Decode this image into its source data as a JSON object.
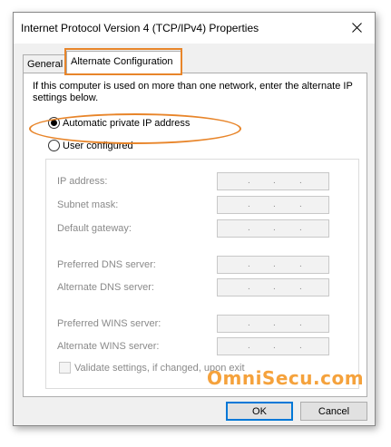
{
  "window": {
    "title": "Internet Protocol Version 4 (TCP/IPv4) Properties"
  },
  "tabs": [
    {
      "label": "General",
      "selected": false
    },
    {
      "label": "Alternate Configuration",
      "selected": true
    }
  ],
  "panel": {
    "description": "If this computer is used on more than one network, enter the alternate IP settings below.",
    "options": {
      "automatic": {
        "label": "Automatic private IP address",
        "checked": true
      },
      "user": {
        "label": "User configured",
        "checked": false
      }
    },
    "fields": {
      "ip_address": {
        "label": "IP address:",
        "value": ". . ."
      },
      "subnet_mask": {
        "label": "Subnet mask:",
        "value": ". . ."
      },
      "default_gateway": {
        "label": "Default gateway:",
        "value": ". . ."
      },
      "preferred_dns": {
        "label": "Preferred DNS server:",
        "value": ". . ."
      },
      "alternate_dns": {
        "label": "Alternate DNS server:",
        "value": ". . ."
      },
      "preferred_wins": {
        "label": "Preferred WINS server:",
        "value": ". . ."
      },
      "alternate_wins": {
        "label": "Alternate WINS server:",
        "value": ". . ."
      }
    },
    "validate": {
      "label": "Validate settings, if changed, upon exit",
      "checked": false
    }
  },
  "buttons": {
    "ok": "OK",
    "cancel": "Cancel"
  },
  "watermark": "OmniSecu.com",
  "colors": {
    "highlight": "#e8852a",
    "watermark": "#f5a23c",
    "default_button_border": "#0078d7"
  },
  "icons": {
    "close": "close-icon"
  }
}
